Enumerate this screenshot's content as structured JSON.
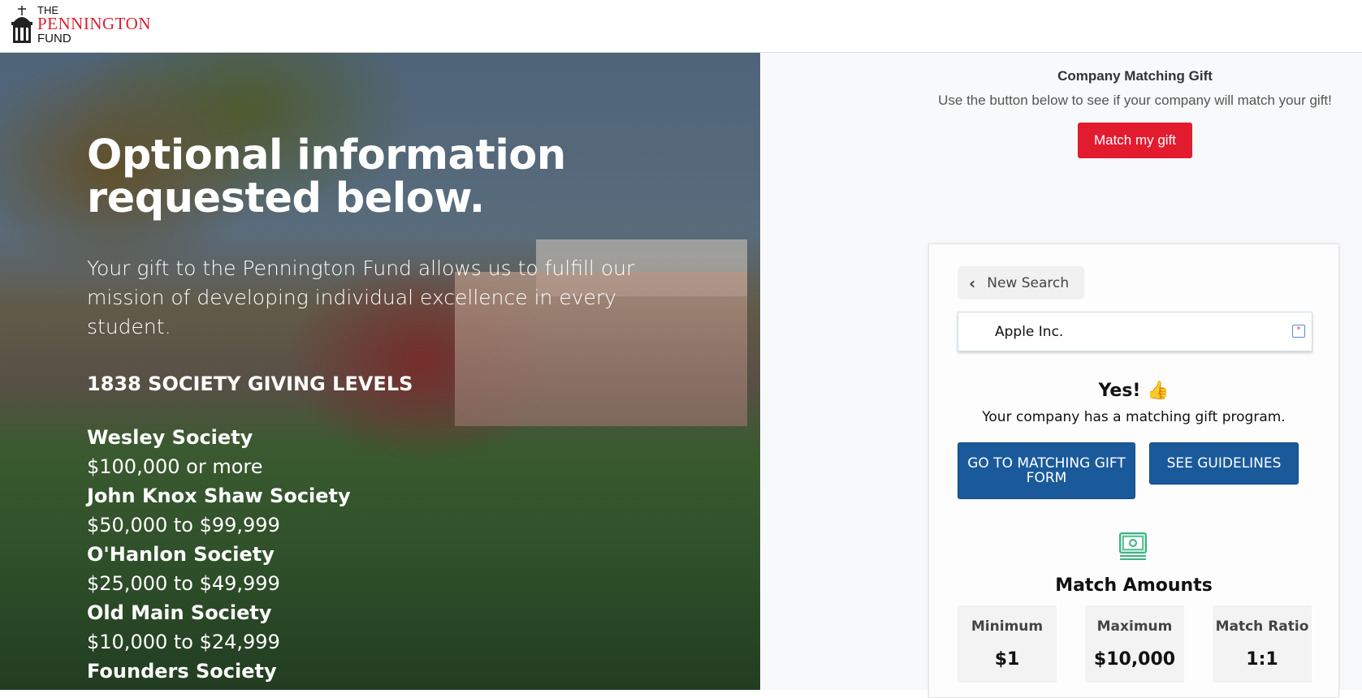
{
  "header": {
    "logo": {
      "the": "THE",
      "pennington": "PENNINGTON",
      "fund": "FUND"
    }
  },
  "hero": {
    "title": "Optional information requested below.",
    "intro": "Your gift to the Pennington Fund allows us to fulfill our mission of developing individual excellence in every student.",
    "levels_title": "1838 SOCIETY GIVING LEVELS",
    "levels": [
      {
        "name": "Wesley Society",
        "amount": "$100,000 or more"
      },
      {
        "name": "John Knox Shaw Society",
        "amount": "$50,000 to $99,999"
      },
      {
        "name": "O'Hanlon Society",
        "amount": "$25,000 to $49,999"
      },
      {
        "name": "Old Main Society",
        "amount": "$10,000 to $24,999"
      },
      {
        "name": "Founders Society",
        "amount": ""
      }
    ]
  },
  "matching": {
    "title": "Company Matching Gift",
    "description": "Use the button below to see if your company will match your gift!",
    "button": "Match my gift",
    "accent": "#e31b2f"
  },
  "card": {
    "new_search": "New Search",
    "company_value": "Apple Inc.",
    "yes": "Yes! 👍",
    "yes_sub": "Your company has a matching gift program.",
    "form_button": "GO TO MATCHING GIFT FORM",
    "guidelines_button": "SEE GUIDELINES",
    "button_color": "#1a5a9a",
    "match_amounts_title": "Match Amounts",
    "amounts": [
      {
        "label": "Minimum",
        "value": "$1"
      },
      {
        "label": "Maximum",
        "value": "$10,000"
      },
      {
        "label": "Match Ratio",
        "value": "1:1"
      }
    ]
  }
}
